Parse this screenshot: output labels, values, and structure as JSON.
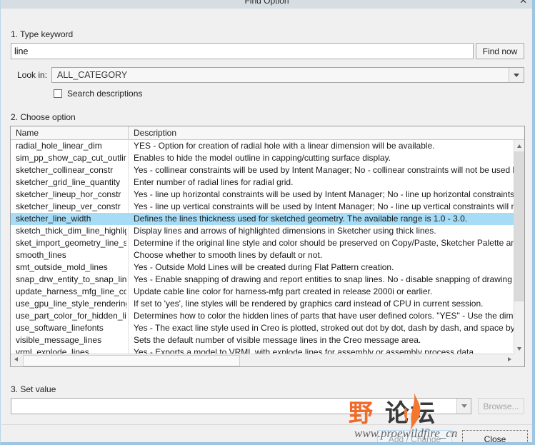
{
  "window": {
    "title": "Find Option",
    "close_icon": "close-icon",
    "close_glyph": "✕"
  },
  "steps": {
    "keyword": "1.  Type keyword",
    "choose": "2.  Choose option",
    "setvalue": "3.  Set value"
  },
  "keyword": {
    "value": "line",
    "placeholder": "",
    "find_now_label": "Find now"
  },
  "lookin": {
    "label": "Look in:",
    "value": "ALL_CATEGORY",
    "arrow_icon": "chevron-down-icon"
  },
  "search_descriptions": {
    "label": "Search descriptions",
    "checked": false
  },
  "grid": {
    "columns": [
      "Name",
      "Description"
    ],
    "selected_index": 6,
    "rows": [
      {
        "name": "radial_hole_linear_dim",
        "desc": "YES - Option for creation of radial hole with a linear dimension will be available."
      },
      {
        "name": "sim_pp_show_cap_cut_outline",
        "desc": "Enables to hide the model outline in capping/cutting surface display."
      },
      {
        "name": "sketcher_collinear_constr",
        "desc": "Yes - collinear constraints will be used by Intent Manager; No - collinear constraints will not be used by"
      },
      {
        "name": "sketcher_grid_line_quantity",
        "desc": "Enter number of radial lines for radial grid."
      },
      {
        "name": "sketcher_lineup_hor_constr",
        "desc": "Yes - line up horizontal constraints will be used by Intent Manager; No - line up horizontal constraints w"
      },
      {
        "name": "sketcher_lineup_ver_constr",
        "desc": "Yes - line up vertical constraints will be used by Intent Manager; No - line up vertical constraints will no"
      },
      {
        "name": "sketcher_line_width",
        "desc": "Defines the lines thickness used for sketched geometry. The available range is 1.0 - 3.0."
      },
      {
        "name": "sketch_thick_dim_line_highlight",
        "desc": "Display lines and arrows of highlighted dimensions in Sketcher using thick lines."
      },
      {
        "name": "sket_import_geometry_line_style",
        "desc": "Determine if the original line style and color should be preserved on Copy/Paste, Sketcher Palette and In"
      },
      {
        "name": "smooth_lines",
        "desc": "Choose whether to smooth lines by default or not."
      },
      {
        "name": "smt_outside_mold_lines",
        "desc": "Yes - Outside Mold Lines will be created during Flat Pattern creation."
      },
      {
        "name": "snap_drw_entity_to_snap_lines",
        "desc": "Yes - Enable snapping of drawing and report entities to snap lines. No - disable snapping of drawing an"
      },
      {
        "name": "update_harness_mfg_line_color",
        "desc": "Update cable line color for harness-mfg part created in release 2000i or earlier."
      },
      {
        "name": "use_gpu_line_style_rendering",
        "desc": "If set to 'yes', line styles will be rendered by graphics card instead of CPU in current session."
      },
      {
        "name": "use_part_color_for_hidden_line",
        "desc": "Determines how to color the hidden lines of parts that have user defined colors. \"YES\" - Use the dimme"
      },
      {
        "name": "use_software_linefonts",
        "desc": "Yes - The exact line style used in Creo is plotted, stroked out dot by dot, dash by dash, and space by spa"
      },
      {
        "name": "visible_message_lines",
        "desc": "Sets the default number of visible message lines in the Creo message area."
      },
      {
        "name": "vrml_explode_lines",
        "desc": "Yes - Exports a model to VRML with explode lines for assembly or assembly process data."
      }
    ]
  },
  "setvalue": {
    "value": "",
    "placeholder": "",
    "arrow_icon": "chevron-down-icon",
    "browse_label": "Browse..."
  },
  "footer": {
    "add_change_label_accel": "A",
    "add_change_label_rest": "dd / Change",
    "close_label": "Close"
  },
  "watermark": {
    "cjk_part1": "野",
    "cjk_part2": "火",
    "cjk_part3": "论坛",
    "url": "www.proewildfire_cn",
    "color_orange": "#f06a2a",
    "color_dark": "#3a3a3a"
  },
  "colors": {
    "selection": "#a6dcf6",
    "dialog_bg": "#f0f0f0",
    "frame": "#9fc6e0",
    "titlebar": "#d6dde3"
  }
}
